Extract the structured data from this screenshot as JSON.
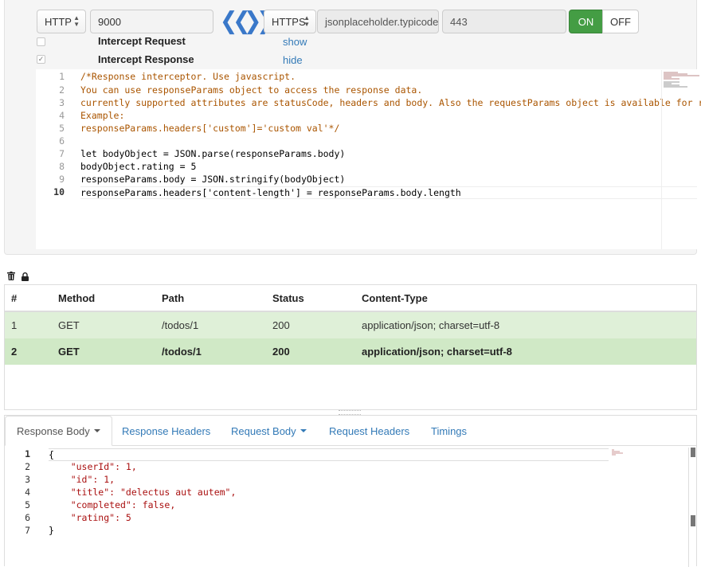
{
  "config": {
    "local_protocol": "HTTP",
    "local_port": "9000",
    "remote_protocol": "HTTPS",
    "remote_host": "jsonplaceholder.typicode.com",
    "remote_port": "443",
    "on_label": "ON",
    "off_label": "OFF",
    "intercept_request": {
      "label": "Intercept Request",
      "checked": false,
      "toggle": "show"
    },
    "intercept_response": {
      "label": "Intercept Response",
      "checked": true,
      "toggle": "hide"
    }
  },
  "editor": {
    "line_numbers": [
      "1",
      "2",
      "3",
      "4",
      "5",
      "6",
      "7",
      "8",
      "9",
      "10"
    ],
    "lines": [
      "/*Response interceptor. Use javascript.",
      "You can use responseParams object to access the response data.",
      "currently supported attributes are statusCode, headers and body. Also the requestParams object is available for r",
      "Example:",
      "responseParams.headers['custom']='custom val'*/",
      "",
      "let bodyObject = JSON.parse(responseParams.body)",
      "bodyObject.rating = 5",
      "responseParams.body = JSON.stringify(bodyObject)",
      "responseParams.headers['content-length'] = responseParams.body.length"
    ]
  },
  "toolbar": {
    "trash_icon": "trash-icon",
    "lock_icon": "lock-icon"
  },
  "table": {
    "headers": [
      "#",
      "Method",
      "Path",
      "Status",
      "Content-Type"
    ],
    "rows": [
      [
        "1",
        "GET",
        "/todos/1",
        "200",
        "application/json; charset=utf-8"
      ],
      [
        "2",
        "GET",
        "/todos/1",
        "200",
        "application/json; charset=utf-8"
      ]
    ]
  },
  "tabs": [
    "Response Body",
    "Response Headers",
    "Request Body",
    "Request Headers",
    "Timings"
  ],
  "response": {
    "line_numbers": [
      "1",
      "2",
      "3",
      "4",
      "5",
      "6",
      "7"
    ],
    "lines": [
      "{",
      "    \"userId\": 1,",
      "    \"id\": 1,",
      "    \"title\": \"delectus aut autem\",",
      "    \"completed\": false,",
      "    \"rating\": 5",
      "}"
    ]
  },
  "colors": {
    "accent": "#337ab7",
    "on": "#449d44",
    "row1": "#dff0d8",
    "row2": "#d0e9c6"
  }
}
